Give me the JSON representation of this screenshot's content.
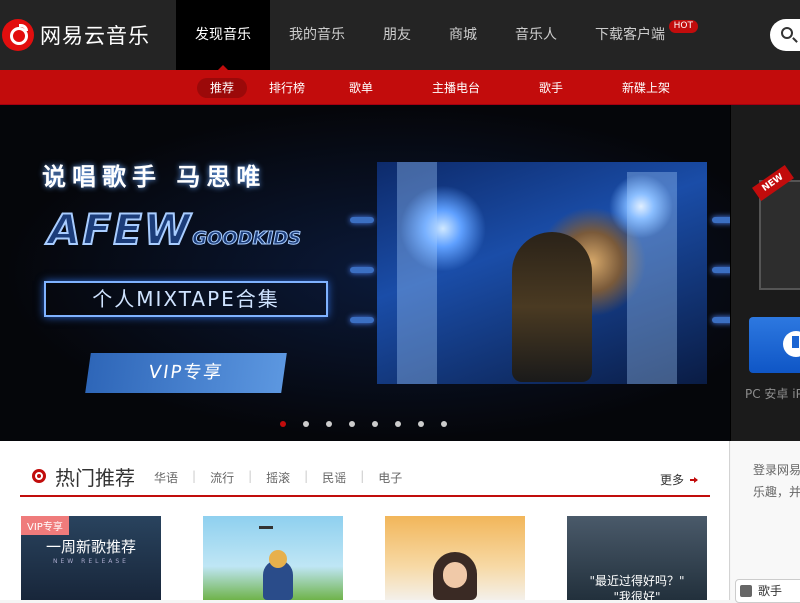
{
  "brand": {
    "name": "网易云音乐",
    "accent": "#c20c0c",
    "logo_icon": "netease-music-logo-icon"
  },
  "nav": {
    "items": [
      "发现音乐",
      "我的音乐",
      "朋友",
      "商城",
      "音乐人",
      "下载客户端"
    ],
    "active_index": 0,
    "hot_badge": "HOT"
  },
  "search": {
    "icon": "search-icon"
  },
  "subnav": {
    "items": [
      "推荐",
      "排行榜",
      "歌单",
      "主播电台",
      "歌手",
      "新碟上架"
    ],
    "active_index": 0
  },
  "banner": {
    "title": "说唱歌手  马思唯",
    "logo_text": "AFEW",
    "logo_sub": "GOODKIDS",
    "mixtape": "个人MIXTAPE合集",
    "vip_label": "VIP专享",
    "dots_count": 8,
    "active_dot": 0
  },
  "download": {
    "new_badge": "NEW",
    "platforms": "PC 安卓 iP"
  },
  "hot": {
    "title": "热门推荐",
    "tags": [
      "华语",
      "流行",
      "摇滚",
      "民谣",
      "电子"
    ],
    "more": "更多"
  },
  "cards": [
    {
      "vip_tag": "VIP专享",
      "caption": "一周新歌推荐",
      "sub": "NEW RELEASE"
    },
    {
      "caption": ""
    },
    {
      "caption": ""
    },
    {
      "caption": "\"最近过得好吗？\"",
      "caption2": "\"我很好\""
    }
  ],
  "login": {
    "text": "登录网易 乐趣，并",
    "singer_label": "歌手"
  }
}
